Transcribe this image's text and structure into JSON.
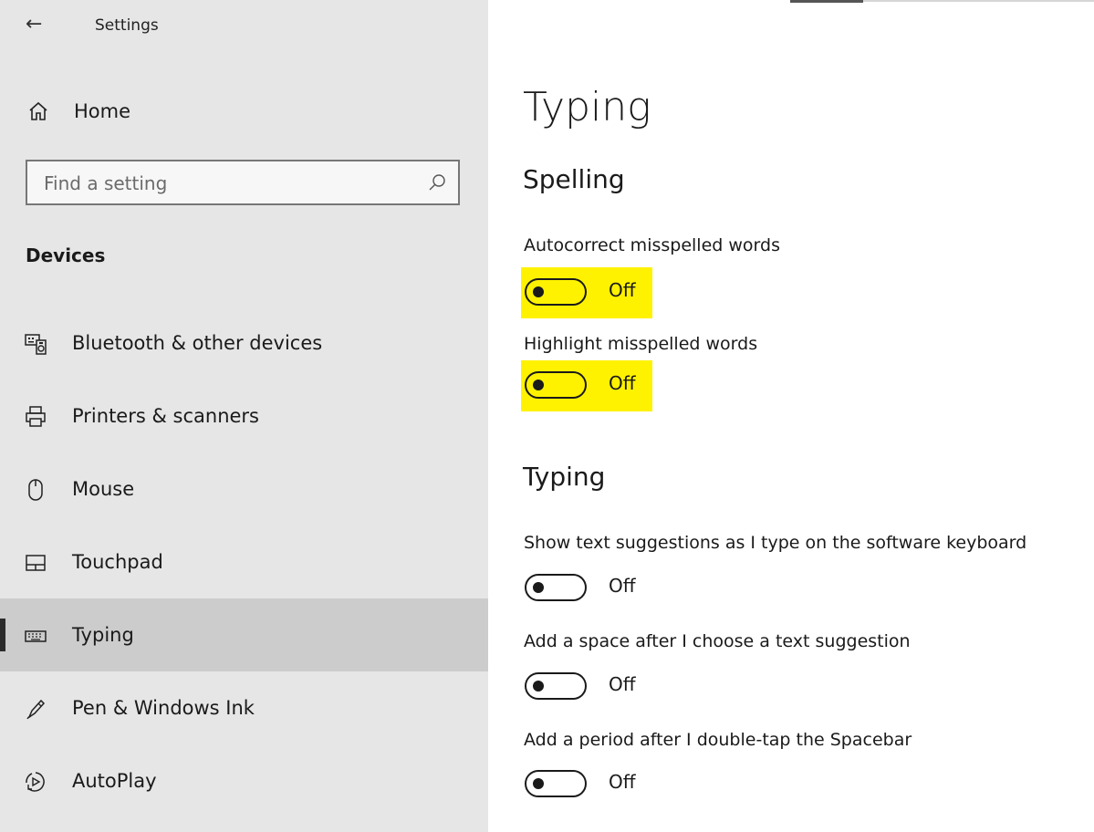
{
  "window": {
    "title": "Settings"
  },
  "sidebar": {
    "home_label": "Home",
    "search_placeholder": "Find a setting",
    "section_title": "Devices",
    "items": [
      {
        "label": "Bluetooth & other devices",
        "icon": "bluetooth-devices-icon"
      },
      {
        "label": "Printers & scanners",
        "icon": "printer-icon"
      },
      {
        "label": "Mouse",
        "icon": "mouse-icon"
      },
      {
        "label": "Touchpad",
        "icon": "touchpad-icon"
      },
      {
        "label": "Typing",
        "icon": "keyboard-icon",
        "selected": true
      },
      {
        "label": "Pen & Windows Ink",
        "icon": "pen-icon"
      },
      {
        "label": "AutoPlay",
        "icon": "autoplay-icon"
      }
    ]
  },
  "main": {
    "page_title": "Typing",
    "groups": [
      {
        "title": "Spelling",
        "settings": [
          {
            "label": "Autocorrect misspelled words",
            "state": "Off",
            "on": false,
            "highlighted": true
          },
          {
            "label": "Highlight misspelled words",
            "state": "Off",
            "on": false,
            "highlighted": true
          }
        ]
      },
      {
        "title": "Typing",
        "settings": [
          {
            "label": "Show text suggestions as I type on the software keyboard",
            "state": "Off",
            "on": false
          },
          {
            "label": "Add a space after I choose a text suggestion",
            "state": "Off",
            "on": false
          },
          {
            "label": "Add a period after I double-tap the Spacebar",
            "state": "Off",
            "on": false
          }
        ]
      }
    ]
  },
  "colors": {
    "highlight": "#fff200",
    "sidebar_bg": "#e6e6e6",
    "selected_bg": "#cccccc"
  }
}
